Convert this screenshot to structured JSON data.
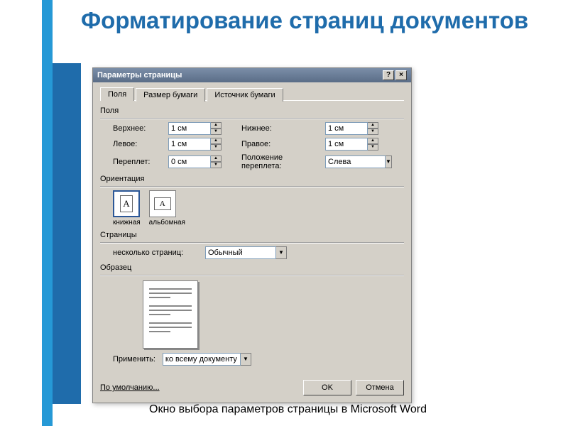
{
  "slide": {
    "title": "Форматирование страниц документов",
    "caption": "Окно выбора параметров страницы в Microsoft Word"
  },
  "dialog": {
    "title": "Параметры страницы",
    "help_btn": "?",
    "close_btn": "×",
    "tabs": {
      "fields": "Поля",
      "paper_size": "Размер бумаги",
      "paper_source": "Источник бумаги"
    },
    "groups": {
      "fields": "Поля",
      "orientation": "Ориентация",
      "pages": "Страницы",
      "sample": "Образец"
    },
    "labels": {
      "top": "Верхнее:",
      "bottom": "Нижнее:",
      "left": "Левое:",
      "right": "Правое:",
      "gutter": "Переплет:",
      "gutter_pos": "Положение переплета:",
      "portrait": "книжная",
      "landscape": "альбомная",
      "multi_pages": "несколько страниц:",
      "apply_to": "Применить:",
      "default": "По умолчанию...",
      "ok": "OK",
      "cancel": "Отмена"
    },
    "values": {
      "top": "1 см",
      "bottom": "1 см",
      "left": "1 см",
      "right": "1 см",
      "gutter": "0 см",
      "gutter_pos": "Слева",
      "multi_pages": "Обычный",
      "apply_to": "ко всему документу"
    }
  }
}
